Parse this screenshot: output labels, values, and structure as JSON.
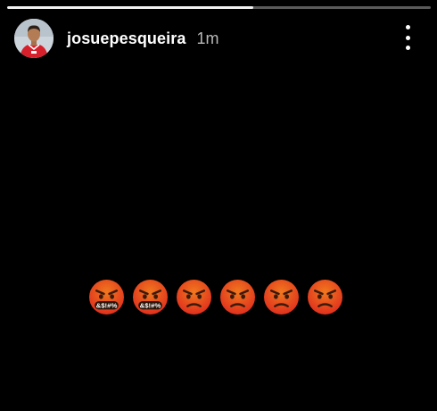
{
  "story": {
    "progress": 0.58,
    "author": {
      "username": "josuepesqueira",
      "posted": "1m",
      "avatar_icon": "profile-photo-icon"
    },
    "more_icon": "more-vertical-icon",
    "content": {
      "emojis": [
        {
          "icon": "face-with-symbols-on-mouth-icon",
          "symbols": "&$!#%"
        },
        {
          "icon": "face-with-symbols-on-mouth-icon",
          "symbols": "&$!#%"
        },
        {
          "icon": "angry-face-icon"
        },
        {
          "icon": "angry-face-icon"
        },
        {
          "icon": "angry-face-icon"
        },
        {
          "icon": "angry-face-icon"
        }
      ]
    }
  },
  "colors": {
    "background": "#000000",
    "progress_track": "#5a5a5a",
    "progress_fill": "#f2f2f2",
    "emoji_orange": "#f0781e",
    "emoji_red": "#e0301e"
  }
}
